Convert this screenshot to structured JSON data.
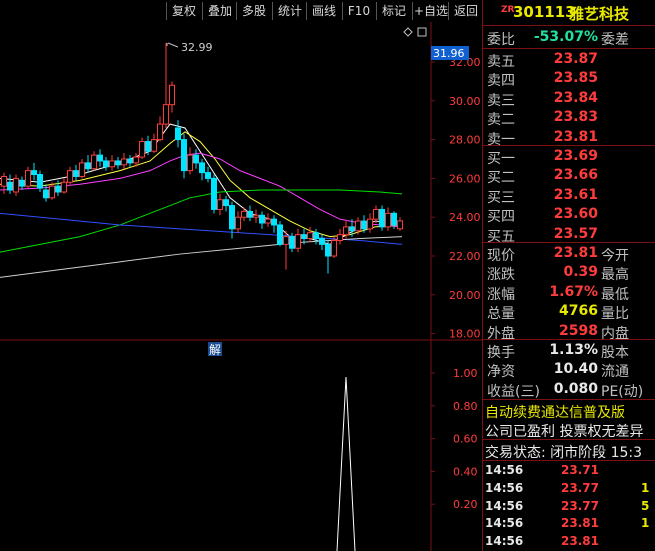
{
  "toolbar": {
    "buttons": [
      "复权",
      "叠加",
      "多股",
      "统计",
      "画线",
      "F10",
      "标记",
      "+自选",
      "返回"
    ]
  },
  "header": {
    "code_prefix": "ZR",
    "code": "301113",
    "name": "雅艺科技"
  },
  "chart": {
    "price_ticks": [
      "32.00",
      "30.00",
      "28.00",
      "26.00",
      "24.00",
      "22.00",
      "20.00",
      "18.00"
    ],
    "current_price_label": "31.96",
    "high_label": "32.99",
    "indicator_label": "解",
    "indicator_ticks": [
      "1.00",
      "0.80",
      "0.60",
      "0.40",
      "0.20"
    ],
    "colors": {
      "up": "#ff3c3c",
      "down": "#00e5ff",
      "ma5": "#ffffff",
      "ma10": "#ffff40",
      "ma20": "#ff40ff",
      "ma60": "#00e000",
      "ma120": "#3050ff",
      "ma250": "#d0d0d0"
    }
  },
  "quote": {
    "weibi": {
      "label": "委比",
      "value": "-53.07%",
      "label2": "委差"
    },
    "asks": [
      {
        "label": "卖五",
        "price": "23.87"
      },
      {
        "label": "卖四",
        "price": "23.85"
      },
      {
        "label": "卖三",
        "price": "23.84"
      },
      {
        "label": "卖二",
        "price": "23.83"
      },
      {
        "label": "卖一",
        "price": "23.81"
      }
    ],
    "bids": [
      {
        "label": "买一",
        "price": "23.69"
      },
      {
        "label": "买二",
        "price": "23.66"
      },
      {
        "label": "买三",
        "price": "23.61"
      },
      {
        "label": "买四",
        "price": "23.60"
      },
      {
        "label": "买五",
        "price": "23.57"
      }
    ],
    "stats": [
      {
        "label": "现价",
        "value": "23.81",
        "label2": "今开",
        "cls": "red"
      },
      {
        "label": "涨跌",
        "value": "0.39",
        "label2": "最高",
        "cls": "red"
      },
      {
        "label": "涨幅",
        "value": "1.67%",
        "label2": "最低",
        "cls": "red"
      },
      {
        "label": "总量",
        "value": "4766",
        "label2": "量比",
        "cls": "yellow"
      },
      {
        "label": "外盘",
        "value": "2598",
        "label2": "内盘",
        "cls": "red"
      }
    ],
    "fundamentals": [
      {
        "label": "换手",
        "value": "1.13%",
        "label2": "股本"
      },
      {
        "label": "净资",
        "value": "10.40",
        "label2": "流通"
      },
      {
        "label": "收益(三)",
        "value": "0.080",
        "label2": "PE(动)"
      }
    ],
    "ticker1": "自动续费通达信普及版",
    "ticker2": "公司已盈利 投票权无差异",
    "status": "交易状态: 闭市阶段 15:3",
    "trades": [
      {
        "time": "14:56",
        "price": "23.71",
        "vol": ""
      },
      {
        "time": "14:56",
        "price": "23.77",
        "vol": "1"
      },
      {
        "time": "14:56",
        "price": "23.77",
        "vol": "5"
      },
      {
        "time": "14:56",
        "price": "23.81",
        "vol": "1"
      },
      {
        "time": "14:56",
        "price": "23.81",
        "vol": ""
      }
    ]
  }
}
